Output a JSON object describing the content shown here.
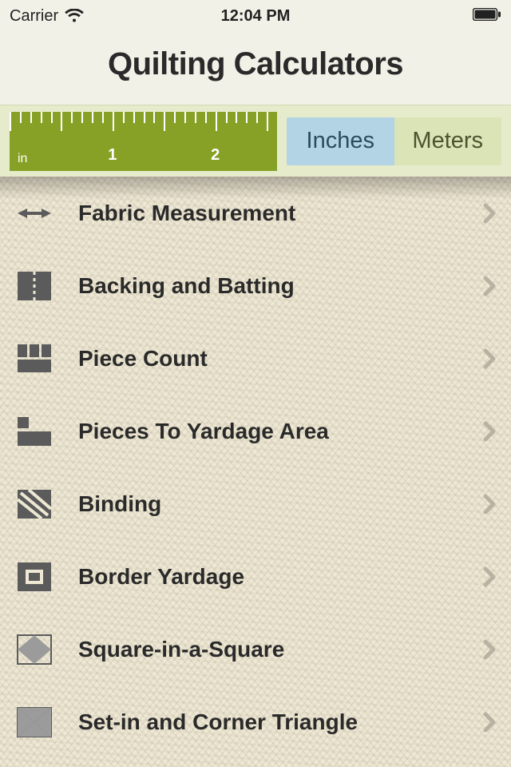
{
  "statusbar": {
    "carrier": "Carrier",
    "time": "12:04 PM"
  },
  "title": "Quilting Calculators",
  "ruler": {
    "unit_label": "in",
    "label_1": "1",
    "label_2": "2"
  },
  "units": {
    "inches": "Inches",
    "meters": "Meters",
    "selected": "inches"
  },
  "menu": {
    "items": [
      {
        "label": "Fabric Measurement",
        "icon": "measure-icon"
      },
      {
        "label": "Backing and Batting",
        "icon": "backing-icon"
      },
      {
        "label": "Piece Count",
        "icon": "piececount-icon"
      },
      {
        "label": "Pieces To Yardage Area",
        "icon": "yardage-icon"
      },
      {
        "label": "Binding",
        "icon": "binding-icon"
      },
      {
        "label": "Border Yardage",
        "icon": "border-icon"
      },
      {
        "label": "Square-in-a-Square",
        "icon": "sqinsq-icon"
      },
      {
        "label": "Set-in and Corner Triangle",
        "icon": "corner-icon"
      }
    ]
  }
}
